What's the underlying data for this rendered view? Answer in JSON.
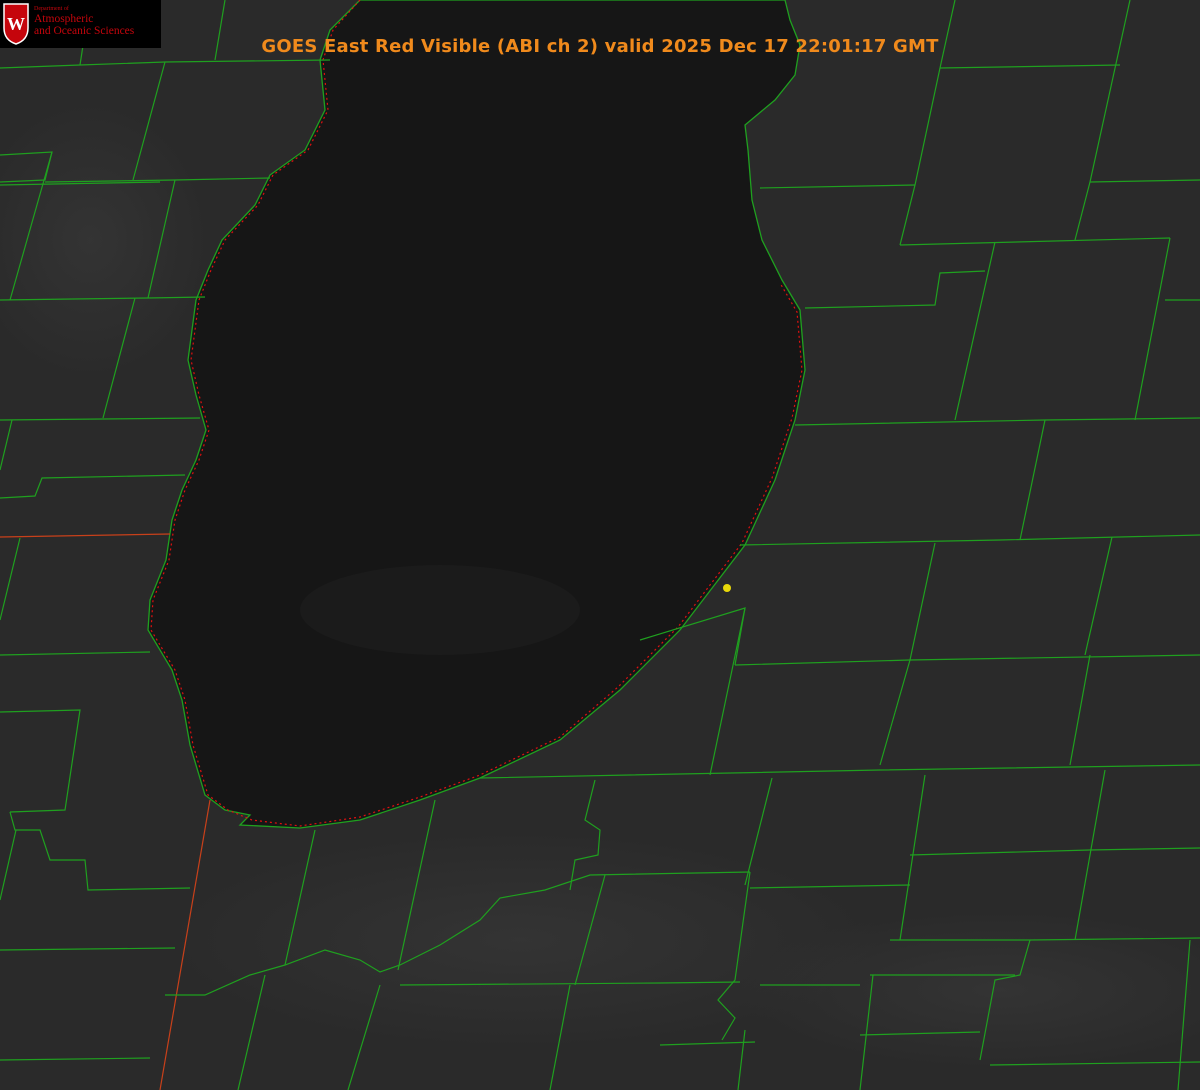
{
  "header": {
    "title": "GOES East Red Visible (ABI ch 2) valid 2025 Dec 17 22:01:17 GMT"
  },
  "logo": {
    "dept_line": "Department of",
    "name_line1": "Atmospheric",
    "name_line2": "and Oceanic Sciences",
    "crest_letter": "W"
  },
  "colors": {
    "background": "#000000",
    "land": "#2a2a2a",
    "lake": "#151515",
    "county_lines": "#1fa01f",
    "state_line": "#c8401a",
    "shoreline_dotted": "#e01010",
    "marker": "#e8d80a",
    "title": "#f08a1c",
    "logo_red": "#c5050c"
  },
  "map_features": {
    "lake": "lake-michigan-southern-basin",
    "marker_icon": "yellow-dot-marker"
  }
}
